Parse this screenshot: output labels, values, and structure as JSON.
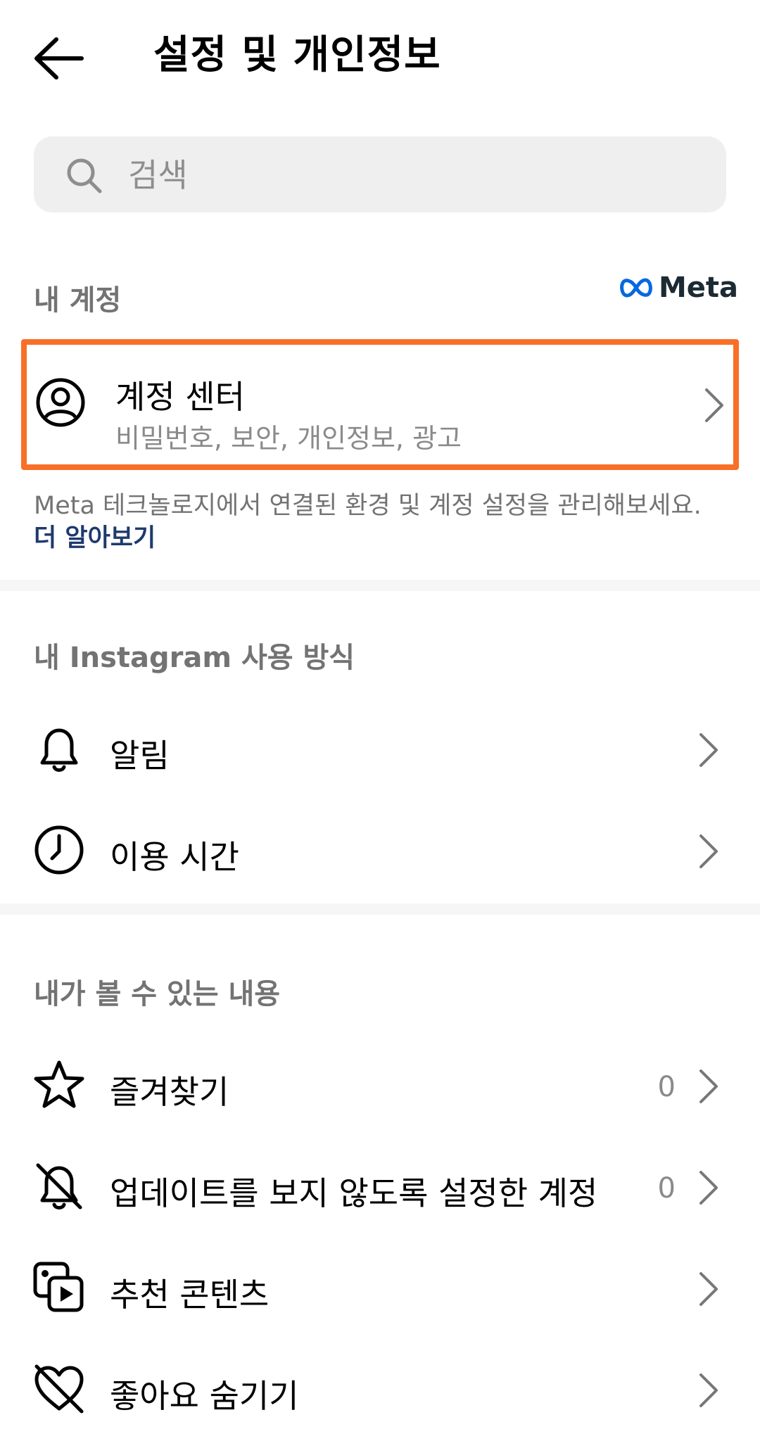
{
  "header": {
    "title": "설정 및 개인정보"
  },
  "search": {
    "placeholder": "검색"
  },
  "my_account": {
    "section_label": "내 계정",
    "brand": "Meta",
    "accounts_center": {
      "title": "계정 센터",
      "subtitle": "비밀번호, 보안, 개인정보, 광고"
    },
    "description": "Meta 테크놀로지에서 연결된 환경 및 계정 설정을 관리해보세요.",
    "learn_more": "더 알아보기"
  },
  "how_you_use": {
    "section_label": "내 Instagram 사용 방식",
    "items": [
      {
        "label": "알림",
        "icon": "bell-icon"
      },
      {
        "label": "이용 시간",
        "icon": "clock-icon"
      }
    ]
  },
  "what_you_see": {
    "section_label": "내가 볼 수 있는 내용",
    "items": [
      {
        "label": "즐겨찾기",
        "count": "0",
        "icon": "star-icon"
      },
      {
        "label": "업데이트를 보지 않도록 설정한 계정",
        "count": "0",
        "icon": "bell-off-icon"
      },
      {
        "label": "추천 콘텐츠",
        "icon": "suggested-content-icon"
      },
      {
        "label": "좋아요 숨기기",
        "icon": "heart-off-icon"
      }
    ]
  },
  "colors": {
    "highlight": "#f86f27",
    "link": "#1e3a6e",
    "meta_blue": "#0668e1"
  }
}
